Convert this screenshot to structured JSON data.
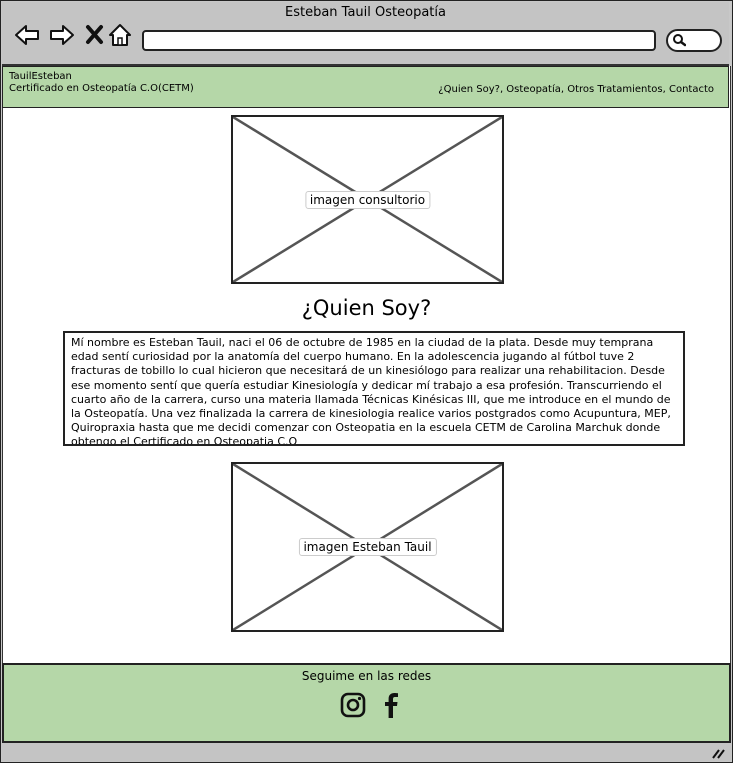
{
  "window": {
    "title": "Esteban Tauil Osteopatía"
  },
  "browser": {
    "back_icon": "arrow-left-icon",
    "forward_icon": "arrow-right-icon",
    "stop_icon": "close-icon",
    "home_icon": "home-icon",
    "search_icon": "search-icon",
    "url": ""
  },
  "header": {
    "brand_name": "TauilEsteban",
    "brand_subtitle": "Certificado en Osteopatía C.O(CETM)",
    "nav_links": "¿Quien Soy?, Osteopatía, Otros Tratamientos, Contacto"
  },
  "main": {
    "image1_label": "imagen consultorio",
    "heading": "¿Quien Soy?",
    "bio": "Mí nombre es Esteban Tauil, naci el 06 de octubre de 1985 en la ciudad de la plata. Desde muy temprana edad sentí curiosidad por la anatomía del cuerpo humano. En la adolescencia jugando al fútbol tuve 2 fracturas de tobillo lo cual hicieron que necesitará de un kinesiólogo para realizar una rehabilitacion. Desde ese momento sentí que quería estudiar Kinesiología y dedicar mí trabajo a esa profesión. Transcurriendo el cuarto año de la carrera, curso una materia llamada Técnicas Kinésicas III, que me introduce en el mundo de la Osteopatía. Una vez finalizada la carrera de kinesiologia realice varios postgrados como Acupuntura, MEP, Quiropraxia hasta que me decidi comenzar con Osteopatia en la escuela CETM de Carolina Marchuk donde obtengo el Certificado en Osteopatia C.O",
    "image2_label": "imagen Esteban Tauil"
  },
  "footer": {
    "title": "Seguime en las redes",
    "icons": [
      "instagram-icon",
      "facebook-icon"
    ]
  },
  "colors": {
    "accent_green": "#b5d7a8",
    "chrome_gray": "#c4c4c4"
  }
}
